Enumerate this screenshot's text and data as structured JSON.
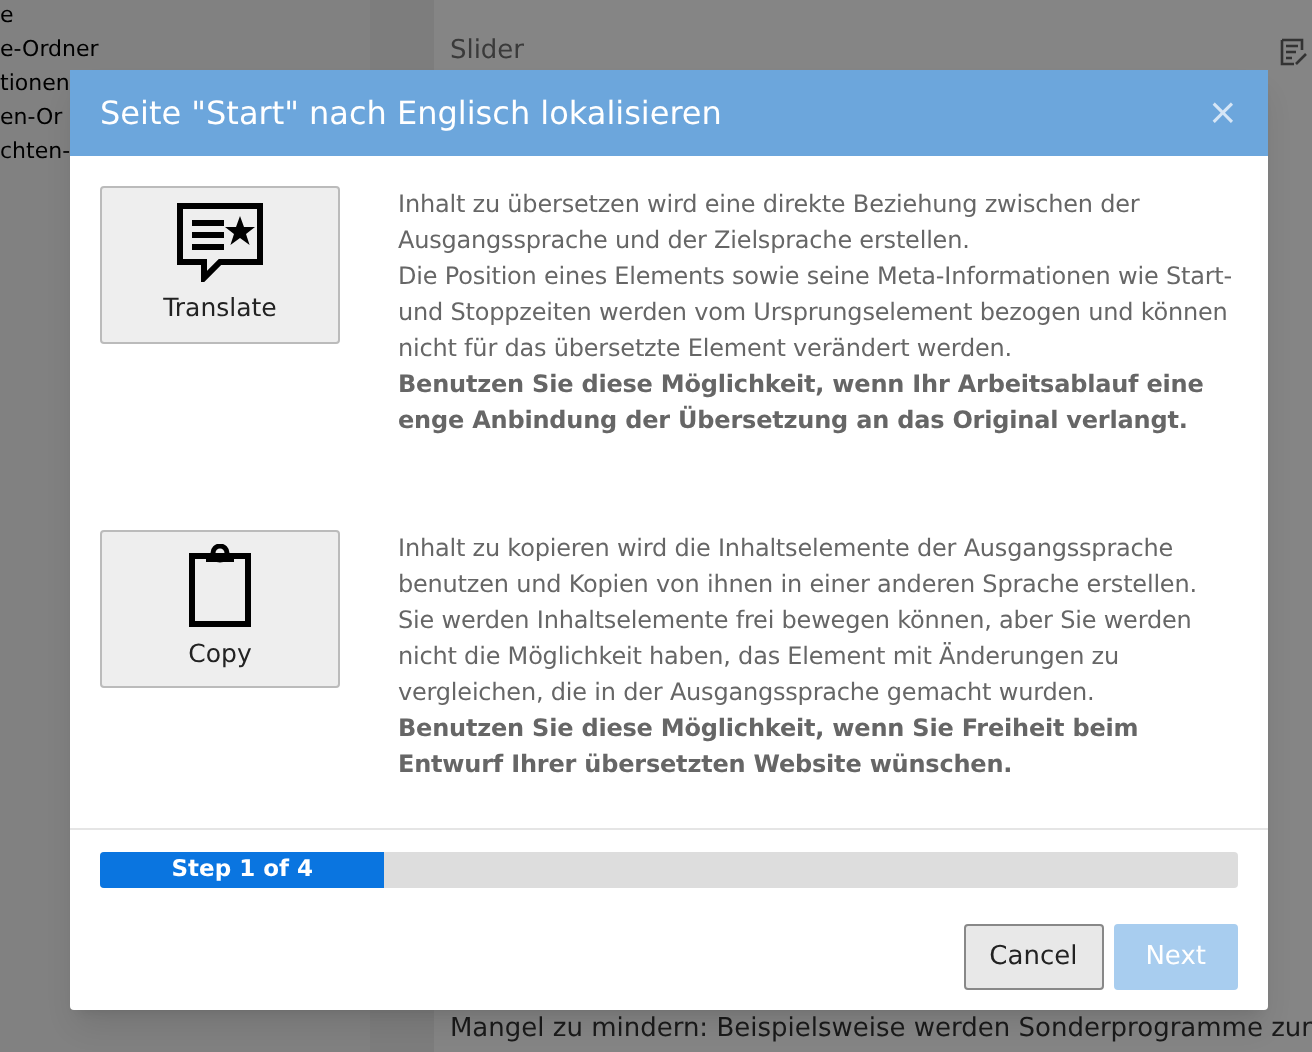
{
  "sidebar": {
    "items": [
      "e",
      "e-Ordner",
      "tionen",
      "en-Or",
      "chten-"
    ]
  },
  "content": {
    "heading": "Slider",
    "footer_text": "Mangel zu mindern: Beispielsweise werden Sonderprogramme zur"
  },
  "dialog": {
    "title": "Seite \"Start\" nach Englisch lokalisieren",
    "close": "×",
    "options": [
      {
        "kind": "translate",
        "label": "Translate",
        "description": "Inhalt zu übersetzen wird eine direkte Beziehung zwischen der Ausgangssprache und der Zielsprache erstellen.\nDie Position eines Elements sowie seine Meta-Informationen wie Start- und Stoppzeiten werden vom Ursprungselement bezogen und können nicht für das übersetzte Element verändert werden.\n**Benutzen Sie diese Möglichkeit, wenn Ihr Arbeitsablauf eine enge Anbindung der Übersetzung an das Original verlangt.**"
      },
      {
        "kind": "copy",
        "label": "Copy",
        "description": "Inhalt zu kopieren wird die Inhaltselemente der Ausgangssprache benutzen und Kopien von ihnen in einer anderen Sprache erstellen. Sie werden Inhaltselemente frei bewegen können, aber Sie werden nicht die Möglichkeit haben, das Element mit Änderungen zu vergleichen, die in der Ausgangssprache gemacht wurden.\n**Benutzen Sie diese Möglichkeit, wenn Sie Freiheit beim Entwurf Ihrer übersetzten Website wünschen.**"
      }
    ],
    "progress": {
      "label": "Step 1 of 4",
      "level": 0.25
    },
    "buttons": [
      {
        "label": "Cancel",
        "disabled": false
      },
      {
        "label": "Next",
        "disabled": true
      }
    ]
  }
}
